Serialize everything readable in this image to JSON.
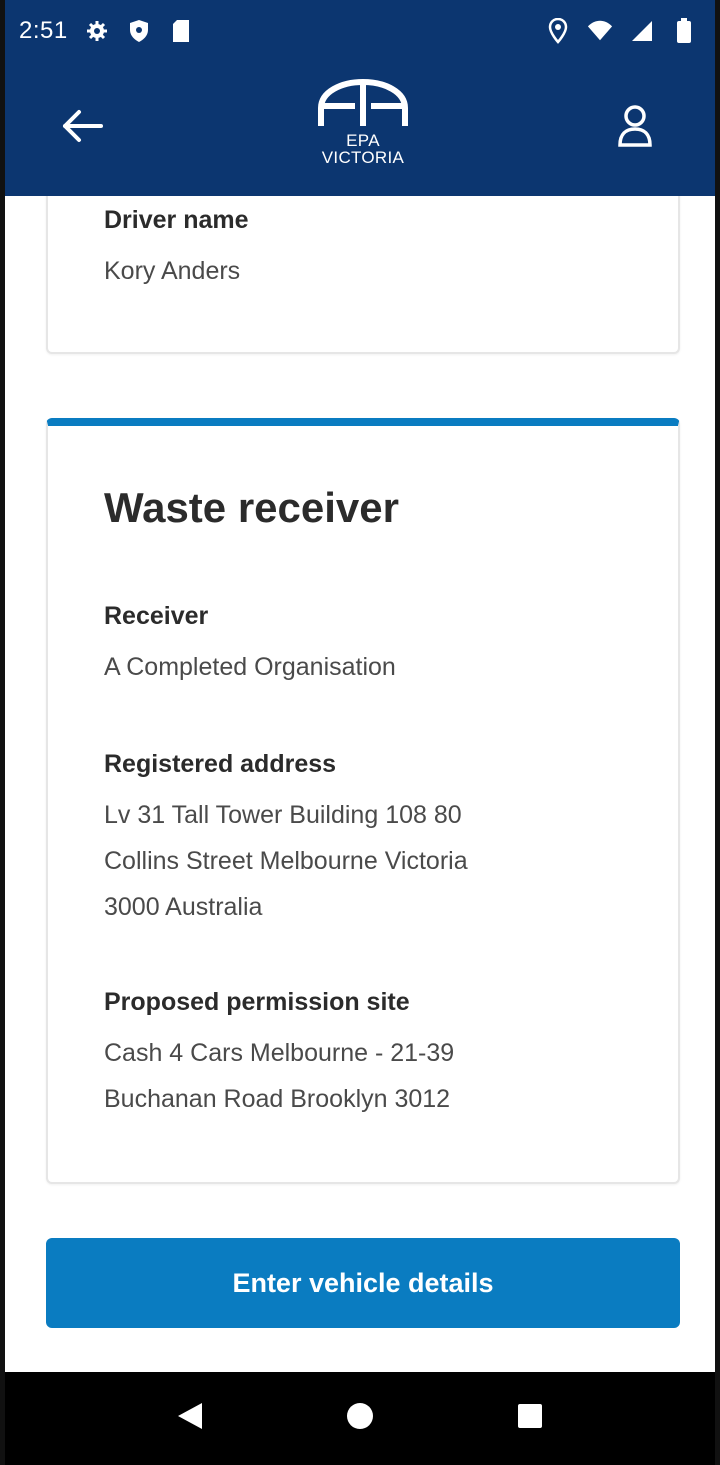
{
  "status_bar": {
    "time": "2:51",
    "left_icons": [
      "gear-icon",
      "shield-icon",
      "sd-card-icon"
    ],
    "right_icons": [
      "location-icon",
      "wifi-icon",
      "signal-icon",
      "battery-icon"
    ]
  },
  "header": {
    "logo_line1": "EPA",
    "logo_line2": "VICTORIA",
    "back_icon": "arrow-left-icon",
    "profile_icon": "user-icon"
  },
  "driver_card": {
    "label": "Driver name",
    "value": "Kory Anders"
  },
  "receiver_card": {
    "title": "Waste receiver",
    "fields": [
      {
        "label": "Receiver",
        "lines": [
          "A Completed Organisation"
        ]
      },
      {
        "label": "Registered address",
        "lines": [
          "Lv 31 Tall Tower Building 108 80",
          "Collins Street Melbourne Victoria",
          "3000 Australia"
        ]
      },
      {
        "label": "Proposed permission site",
        "lines": [
          "Cash 4 Cars Melbourne - 21-39",
          "Buchanan Road Brooklyn 3012"
        ]
      }
    ]
  },
  "primary_action": {
    "label": "Enter vehicle details"
  },
  "nav_bar": {
    "icons": [
      "back-triangle-icon",
      "home-circle-icon",
      "recents-square-icon"
    ]
  },
  "colors": {
    "header_bg": "#0c3670",
    "accent": "#0a7cc1",
    "text": "#2b2b2b"
  }
}
